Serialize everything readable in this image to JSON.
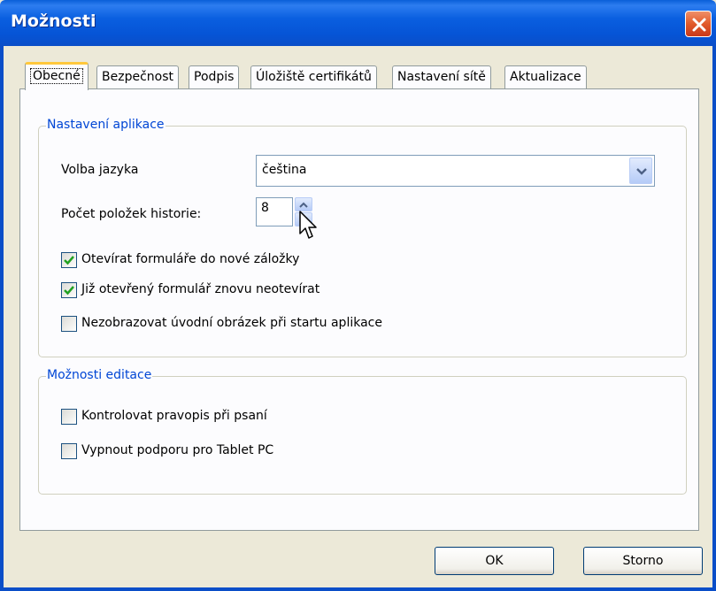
{
  "window": {
    "title": "Možnosti"
  },
  "tabs": [
    {
      "label": "Obecné",
      "active": true
    },
    {
      "label": "Bezpečnost",
      "active": false
    },
    {
      "label": "Podpis",
      "active": false
    },
    {
      "label": "Úložiště certifikátů",
      "active": false
    },
    {
      "label": "Nastavení sítě",
      "active": false
    },
    {
      "label": "Aktualizace",
      "active": false
    }
  ],
  "app_settings": {
    "legend": "Nastavení aplikace",
    "language_label": "Volba jazyka",
    "language_value": "čeština",
    "history_label": "Počet položek historie:",
    "history_value": "8",
    "checkboxes": [
      {
        "label": "Otevírat formuláře do nové záložky",
        "checked": true
      },
      {
        "label": "Již otevřený formulář znovu neotevírat",
        "checked": true
      },
      {
        "label": "Nezobrazovat úvodní obrázek při startu aplikace",
        "checked": false
      }
    ]
  },
  "edit_options": {
    "legend": "Možnosti editace",
    "checkboxes": [
      {
        "label": "Kontrolovat pravopis při psaní",
        "checked": false
      },
      {
        "label": "Vypnout podporu pro Tablet PC",
        "checked": false
      }
    ]
  },
  "buttons": {
    "ok": "OK",
    "cancel": "Storno"
  },
  "icons": {
    "close": "close-icon",
    "dropdown": "chevron-down-icon",
    "spin_up": "arrow-up-icon",
    "spin_down": "arrow-down-icon",
    "check": "checkmark-icon",
    "cursor": "mouse-pointer-icon"
  },
  "colors": {
    "titlebar": "#0a5fd8",
    "group_legend": "#0046d5",
    "close": "#e15a2a",
    "active_tab_accent": "#ffc83c"
  }
}
